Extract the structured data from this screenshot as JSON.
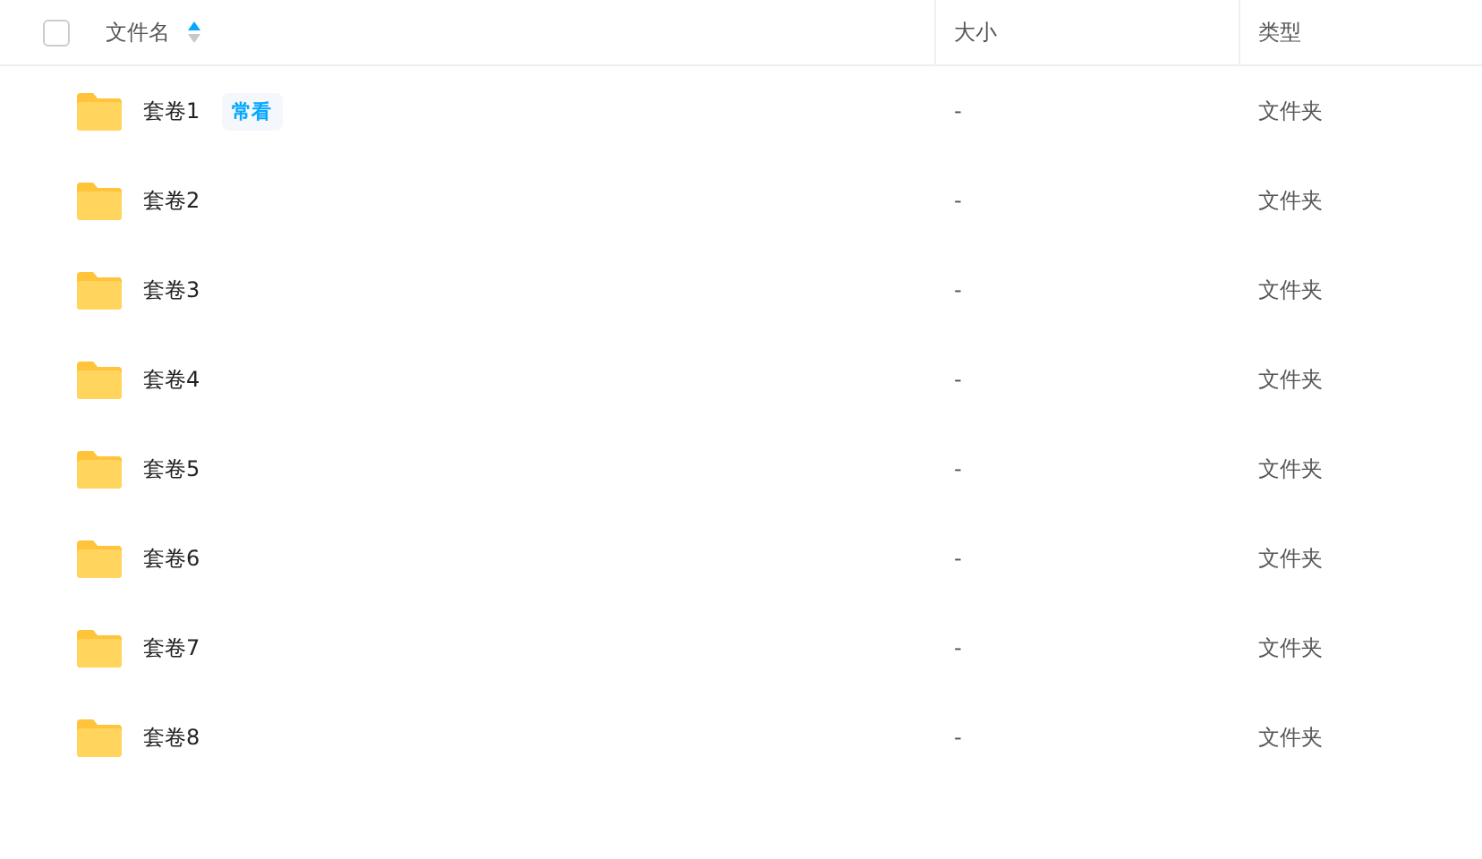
{
  "table": {
    "select_all": {
      "checked": false
    },
    "columns": [
      {
        "label": "文件名",
        "sorted": true
      },
      {
        "label": "大小",
        "sorted": false
      },
      {
        "label": "类型",
        "sorted": false
      }
    ],
    "rows": [
      {
        "name": "套卷1",
        "tag": "常看",
        "size": "-",
        "type": "文件夹"
      },
      {
        "name": "套卷2",
        "size": "-",
        "type": "文件夹"
      },
      {
        "name": "套卷3",
        "size": "-",
        "type": "文件夹"
      },
      {
        "name": "套卷4",
        "size": "-",
        "type": "文件夹"
      },
      {
        "name": "套卷5",
        "size": "-",
        "type": "文件夹"
      },
      {
        "name": "套卷6",
        "size": "-",
        "type": "文件夹"
      },
      {
        "name": "套卷7",
        "size": "-",
        "type": "文件夹"
      },
      {
        "name": "套卷8",
        "size": "-",
        "type": "文件夹"
      }
    ]
  }
}
